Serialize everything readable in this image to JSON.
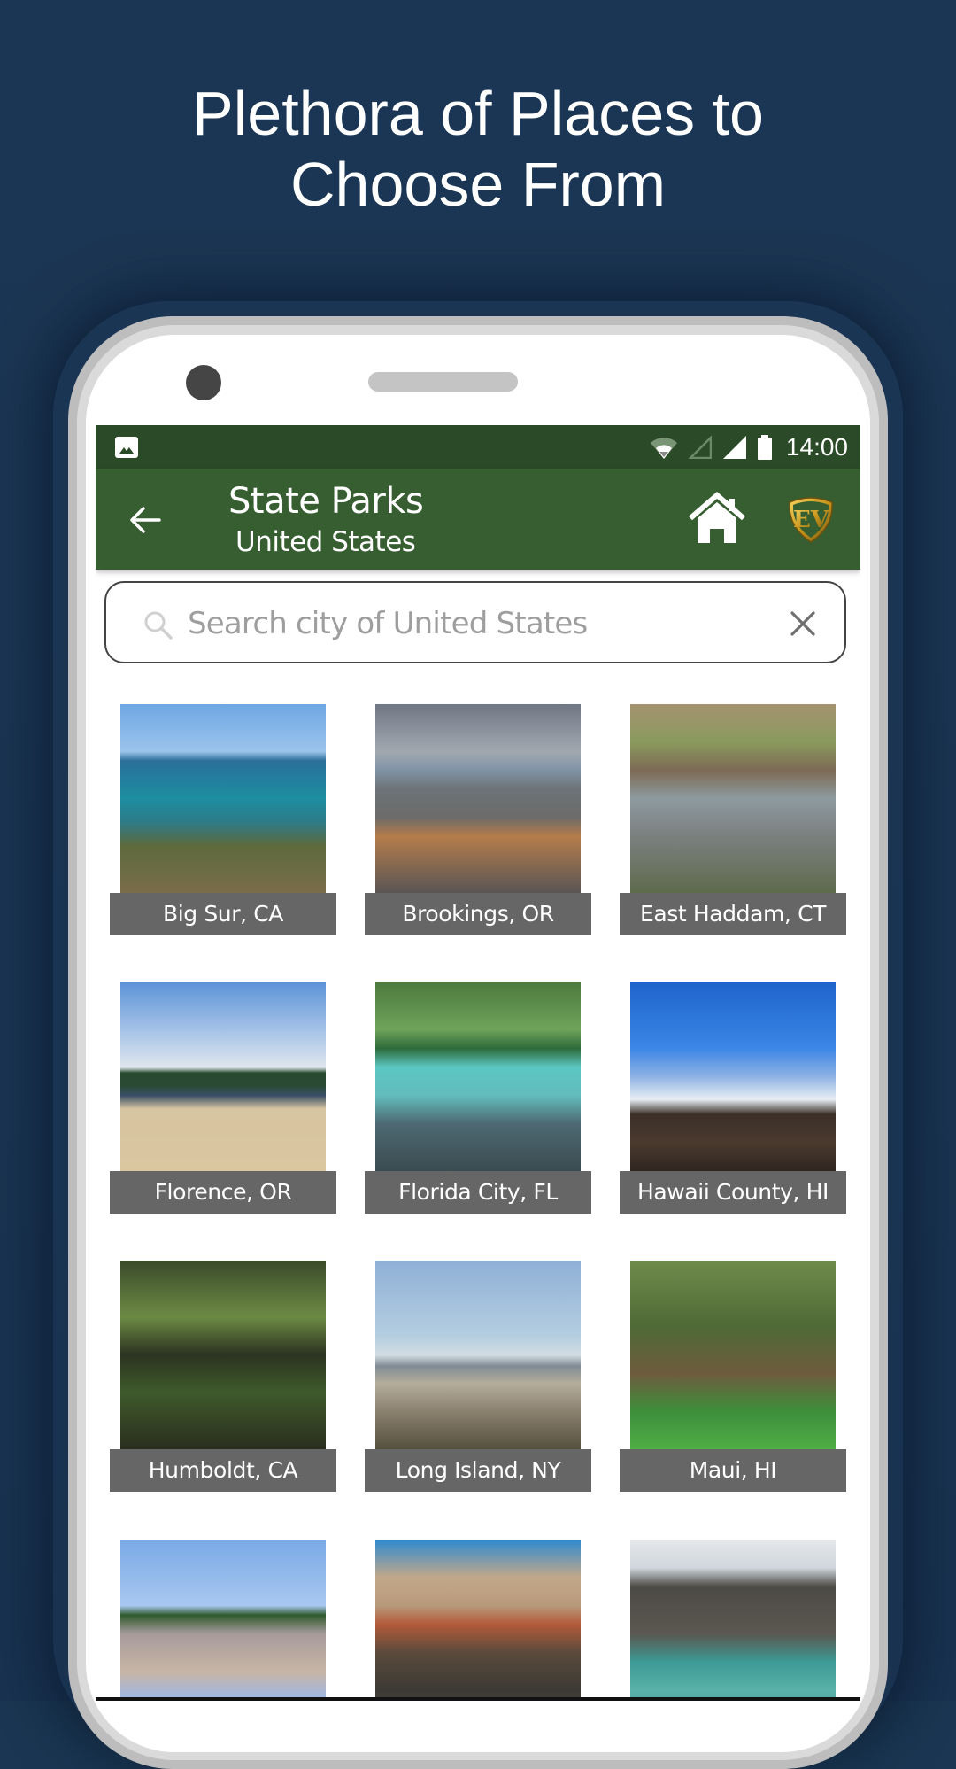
{
  "promo": {
    "headline_line1": "Plethora of Places to",
    "headline_line2": "Choose From",
    "background_color": "#1a3652"
  },
  "status_bar": {
    "notification_icon": "image-icon",
    "icons": [
      "wifi-icon",
      "signal-empty-icon",
      "signal-full-icon",
      "battery-icon"
    ],
    "time": "14:00",
    "color": "#2b4a27"
  },
  "app_bar": {
    "back_icon": "arrow-left-icon",
    "title": "State Parks",
    "subtitle": "United States",
    "home_icon": "home-icon",
    "logo": "EV",
    "color": "#365e31"
  },
  "search": {
    "placeholder": "Search city of United States",
    "value": "",
    "search_icon": "magnifier-icon",
    "clear_icon": "close-icon"
  },
  "places": [
    {
      "label": "Big Sur, CA",
      "scene": "coastal cove with turquoise water"
    },
    {
      "label": "Brookings, OR",
      "scene": "rocky beach under cloudy sky"
    },
    {
      "label": "East Haddam, CT",
      "scene": "waterfall among rocks"
    },
    {
      "label": "Florence, OR",
      "scene": "sand dunes and lake"
    },
    {
      "label": "Florida City, FL",
      "scene": "clear spring with dock"
    },
    {
      "label": "Hawaii County, HI",
      "scene": "volcanic cone above clouds"
    },
    {
      "label": "Humboldt, CA",
      "scene": "redwood forest"
    },
    {
      "label": "Long Island, NY",
      "scene": "beach path with fences"
    },
    {
      "label": "Maui, HI",
      "scene": "bamboo forest"
    },
    {
      "label": "",
      "scene": "sea stacks and cliffs"
    },
    {
      "label": "",
      "scene": "rock arch cave"
    },
    {
      "label": "",
      "scene": "river gorge with rapids"
    }
  ],
  "colors": {
    "label_background": "#666666"
  }
}
